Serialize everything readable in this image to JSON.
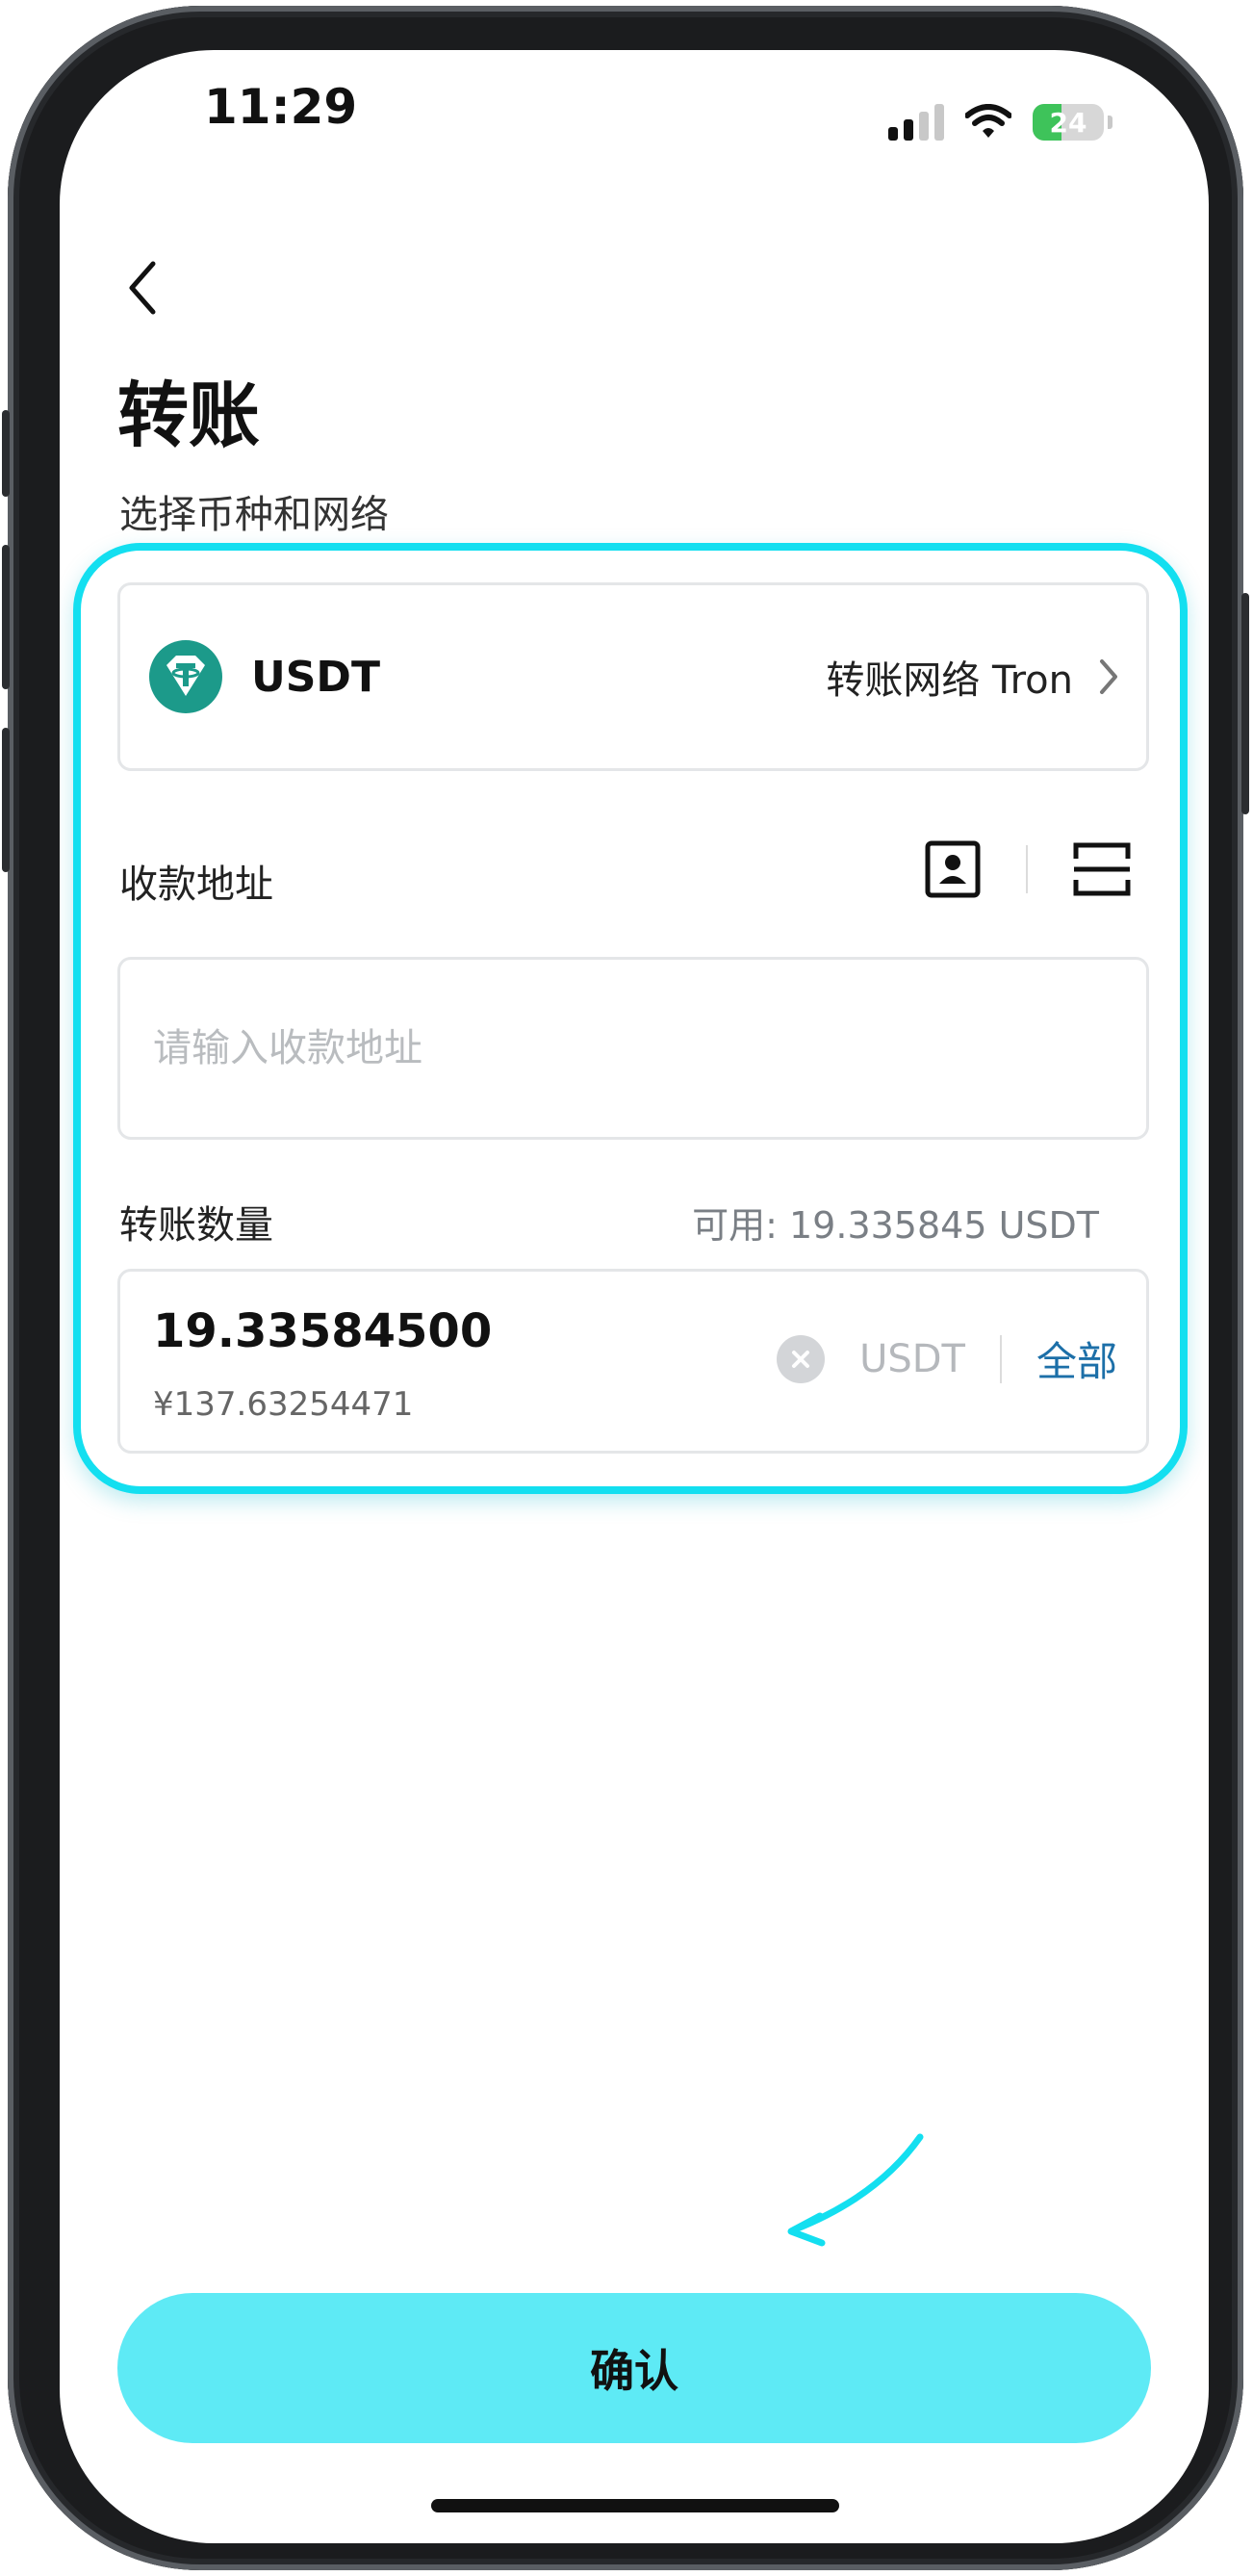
{
  "status_bar": {
    "time": "11:29",
    "battery": "24"
  },
  "header": {
    "title": "转账",
    "subtitle": "选择币种和网络"
  },
  "coin": {
    "name": "USDT",
    "network_label": "转账网络 Tron"
  },
  "address": {
    "label": "收款地址",
    "placeholder": "请输入收款地址",
    "value": ""
  },
  "amount": {
    "label": "转账数量",
    "available": "可用: 19.335845 USDT",
    "value": "19.33584500",
    "fiat": "¥137.63254471",
    "unit": "USDT",
    "all_label": "全部"
  },
  "confirm_label": "确认",
  "colors": {
    "highlight": "#13dff0",
    "confirm_bg": "#5eeaf5",
    "coin_icon": "#1c9a8a",
    "link": "#1c6fa8"
  },
  "icons": {
    "back": "chevron-left-icon",
    "network": "chevron-right-icon",
    "contacts": "address-book-icon",
    "scan": "scan-icon",
    "clear": "clear-icon",
    "coin": "tether-icon"
  }
}
